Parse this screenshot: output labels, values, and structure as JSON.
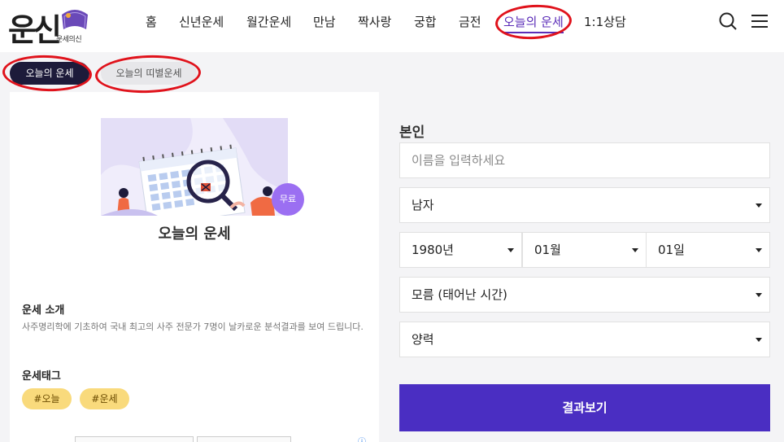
{
  "header": {
    "logo_text": "운신",
    "logo_sub": "운세의신",
    "nav": [
      "홈",
      "신년운세",
      "월간운세",
      "만남",
      "짝사랑",
      "궁합",
      "금전",
      "오늘의 운세",
      "1:1상담"
    ],
    "active_nav": "오늘의 운세",
    "icons": [
      "search-icon",
      "menu-icon"
    ]
  },
  "subtabs": [
    "오늘의 운세",
    "오늘의 띠별운세"
  ],
  "card": {
    "badge": "무료",
    "title": "오늘의 운세",
    "intro_label": "운세 소개",
    "intro_text": "사주명리학에 기초하여 국내 최고의 사주 전문가 7명이 날카로운 분석결과를 보여 드립니다.",
    "tags_label": "운세태그",
    "tags": [
      "#오늘",
      "#운세"
    ]
  },
  "form": {
    "title": "본인",
    "name_placeholder": "이름을 입력하세요",
    "gender": "남자",
    "year": "1980년",
    "month": "01월",
    "day": "01일",
    "birth_time": "모름 (태어난 시간)",
    "calendar": "양력",
    "submit": "결과보기"
  },
  "colors": {
    "accent": "#4a2ec2",
    "active_tab": "#1d1b3a",
    "tag_bg": "#f9da7c",
    "annotation": "#e0121b"
  }
}
